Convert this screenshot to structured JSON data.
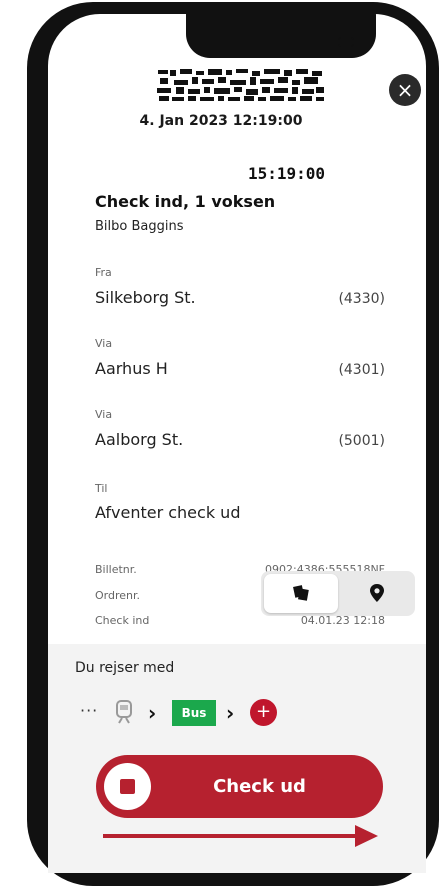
{
  "ticket": {
    "timestamp": "4. Jan 2023 12:19:00",
    "clock": "15:19:00",
    "title": "Check ind, 1 voksen",
    "passenger": "Bilbo Baggins",
    "stops": [
      {
        "label": "Fra",
        "name": "Silkeborg St.",
        "code": "(4330)"
      },
      {
        "label": "Via",
        "name": "Aarhus H",
        "code": "(4301)"
      },
      {
        "label": "Via",
        "name": "Aalborg St.",
        "code": "(5001)"
      },
      {
        "label": "Til",
        "name": "Afventer check ud",
        "code": ""
      }
    ],
    "meta": [
      {
        "label": "Billetnr.",
        "value": "0902:4386:555518NF"
      },
      {
        "label": "Ordrenr.",
        "value": ""
      },
      {
        "label": "Check ind",
        "value": "04.01.23 12:18"
      }
    ]
  },
  "travel": {
    "heading": "Du rejser med",
    "more_dots": "···",
    "bus_label": "Bus",
    "add_symbol": "+"
  },
  "actions": {
    "close_symbol": "×",
    "checkout_label": "Check ud"
  },
  "icons": {
    "close": "close-icon",
    "tickets": "tickets-icon",
    "map_pin": "map-pin-icon",
    "train": "train-icon",
    "stop": "stop-icon",
    "swipe_arrow": "arrow-right-icon"
  },
  "colors": {
    "accent": "#b6212f",
    "bus": "#1ba84c",
    "background": "#ffffff",
    "panel": "#f3f3f3"
  }
}
